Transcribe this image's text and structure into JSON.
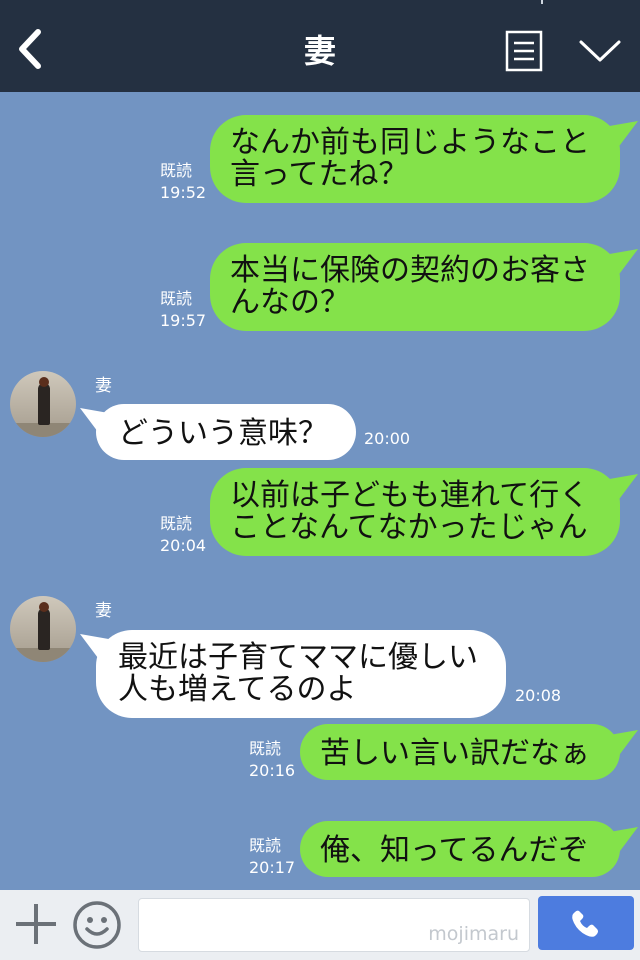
{
  "header": {
    "title": "妻",
    "back_icon": "chevron-left-icon",
    "menu_icon": "list-icon",
    "expand_icon": "chevron-down-icon",
    "background": "#243041"
  },
  "colors": {
    "chat_background": "#7294c2",
    "outgoing_bubble": "#84e24a",
    "incoming_bubble": "#ffffff",
    "send_button": "#4d7cdf"
  },
  "messages": [
    {
      "direction": "outgoing",
      "text": "なんか前も同じようなこと\n言ってたね？",
      "read_label": "既読",
      "time": "19:52"
    },
    {
      "direction": "outgoing",
      "text": "本当に保険の契約のお客さ\nんなの？",
      "read_label": "既読",
      "time": "19:57"
    },
    {
      "direction": "incoming",
      "sender": "妻",
      "text": "どういう意味？",
      "time": "20:00"
    },
    {
      "direction": "outgoing",
      "text": "以前は子どもも連れて行く\nことなんてなかったじゃん",
      "read_label": "既読",
      "time": "20:04"
    },
    {
      "direction": "incoming",
      "sender": "妻",
      "text": "最近は子育てママに優しい\n人も増えてるのよ",
      "time": "20:08"
    },
    {
      "direction": "outgoing",
      "text": "苦しい言い訳だなぁ",
      "read_label": "既読",
      "time": "20:16"
    },
    {
      "direction": "outgoing",
      "text": "俺、知ってるんだぞ",
      "read_label": "既読",
      "time": "20:17"
    }
  ],
  "input_bar": {
    "plus_icon": "plus-icon",
    "emoji_icon": "smiley-icon",
    "input_value": "",
    "watermark": "mojimaru",
    "call_icon": "phone-icon"
  }
}
